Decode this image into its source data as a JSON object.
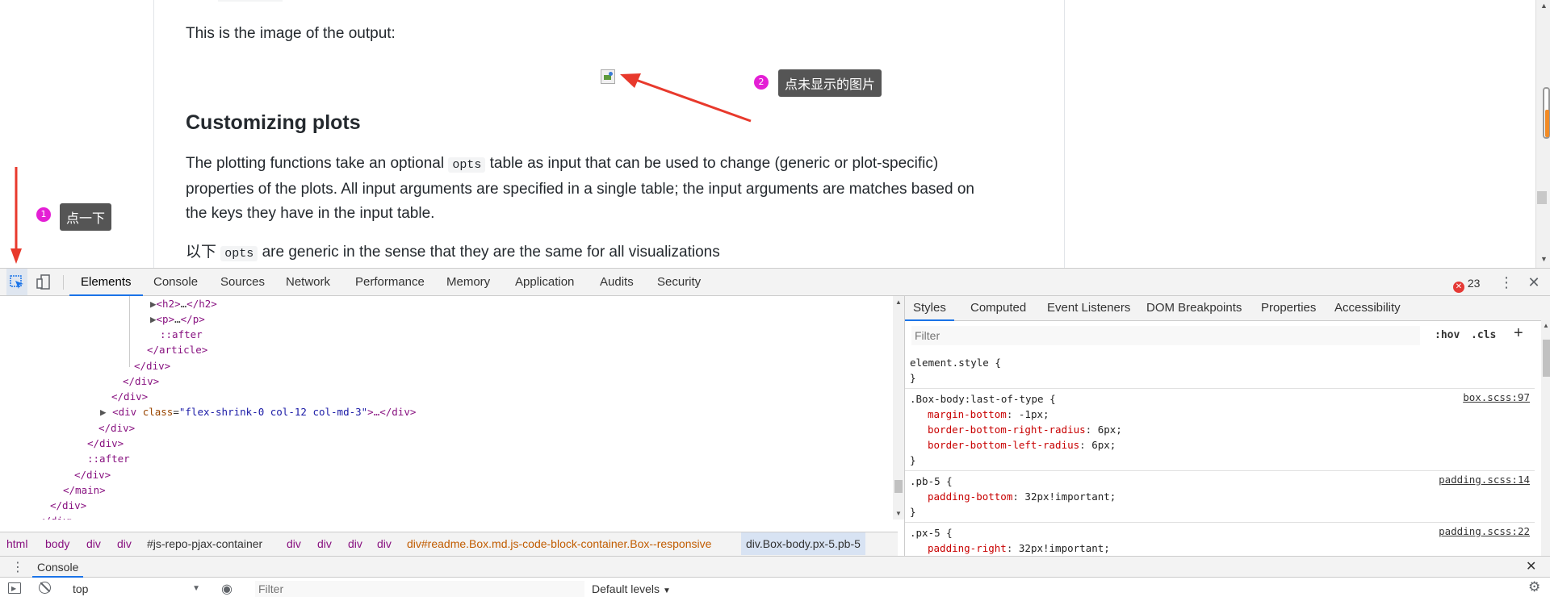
{
  "page": {
    "output_text": "This is the image of the output:",
    "heading": "Customizing plots",
    "para1_a": "The plotting functions take an optional ",
    "para1_code": "opts",
    "para1_b": " table as input that can be used to change (generic or plot-specific)",
    "para1_line2": "properties of the plots. All input arguments are specified in a single table; the input arguments are matches based on",
    "para1_line3": "the keys they have in the input table.",
    "para2_a": "以下 ",
    "para2_code": "opts",
    "para2_b": " are generic in the sense that they are the same for all visualizations"
  },
  "annotations": {
    "badge1": "1",
    "tip1": "点一下",
    "badge2": "2",
    "tip2": "点未显示的图片",
    "arrow_color": "#e8392c"
  },
  "devtools": {
    "tabs": [
      "Elements",
      "Console",
      "Sources",
      "Network",
      "Performance",
      "Memory",
      "Application",
      "Audits",
      "Security"
    ],
    "error_count": "23",
    "elements": {
      "lines": [
        {
          "type": "h2",
          "text_open": "<h2>",
          "ellipsis": "…",
          "text_close": "</h2>"
        },
        {
          "type": "p",
          "text_open": "<p>",
          "ellipsis": "…",
          "text_close": "</p>"
        },
        {
          "type": "pseudo",
          "text": "::after"
        },
        {
          "type": "close",
          "text": "</article>"
        },
        {
          "type": "close",
          "text": "</div>"
        },
        {
          "type": "close",
          "text": "</div>"
        },
        {
          "type": "close",
          "text": "</div>"
        },
        {
          "type": "div",
          "open": "<div ",
          "attr": "class",
          "eq": "=",
          "val": "\"flex-shrink-0 col-12 col-md-3\"",
          "rest": ">…</div>"
        },
        {
          "type": "close",
          "text": "</div>"
        },
        {
          "type": "close",
          "text": "</div>"
        },
        {
          "type": "pseudo",
          "text": "::after"
        },
        {
          "type": "close",
          "text": "</div>"
        },
        {
          "type": "close",
          "text": "</main>"
        },
        {
          "type": "close",
          "text": "</div>"
        },
        {
          "type": "close",
          "text": "</div>"
        }
      ]
    },
    "breadcrumbs": [
      "html",
      "body",
      "div",
      "div",
      "#js-repo-pjax-container",
      "div",
      "div",
      "div",
      "div",
      "div#readme.Box.md.js-code-block-container.Box--responsive",
      "div.Box-body.px-5.pb-5"
    ],
    "styles_tabs": [
      "Styles",
      "Computed",
      "Event Listeners",
      "DOM Breakpoints",
      "Properties",
      "Accessibility"
    ],
    "filter_placeholder": "Filter",
    "hov": ":hov",
    "cls": ".cls",
    "rules": [
      {
        "selector": "element.style {",
        "source": "",
        "props": [],
        "close": "}"
      },
      {
        "selector": ".Box-body:last-of-type {",
        "source": "box.scss:97",
        "props": [
          {
            "name": "margin-bottom",
            "value": "-1px;"
          },
          {
            "name": "border-bottom-right-radius",
            "value": "6px;"
          },
          {
            "name": "border-bottom-left-radius",
            "value": "6px;"
          }
        ],
        "close": "}"
      },
      {
        "selector": ".pb-5 {",
        "source": "padding.scss:14",
        "props": [
          {
            "name": "padding-bottom",
            "value": "32px!important;"
          }
        ],
        "close": "}"
      },
      {
        "selector": ".px-5 {",
        "source": "padding.scss:22",
        "props": [
          {
            "name": "padding-right",
            "value": "32px!important;"
          }
        ],
        "close": ""
      }
    ],
    "console": {
      "drawer_title": "Console",
      "context": "top",
      "filter_placeholder": "Filter",
      "levels": "Default levels"
    }
  }
}
